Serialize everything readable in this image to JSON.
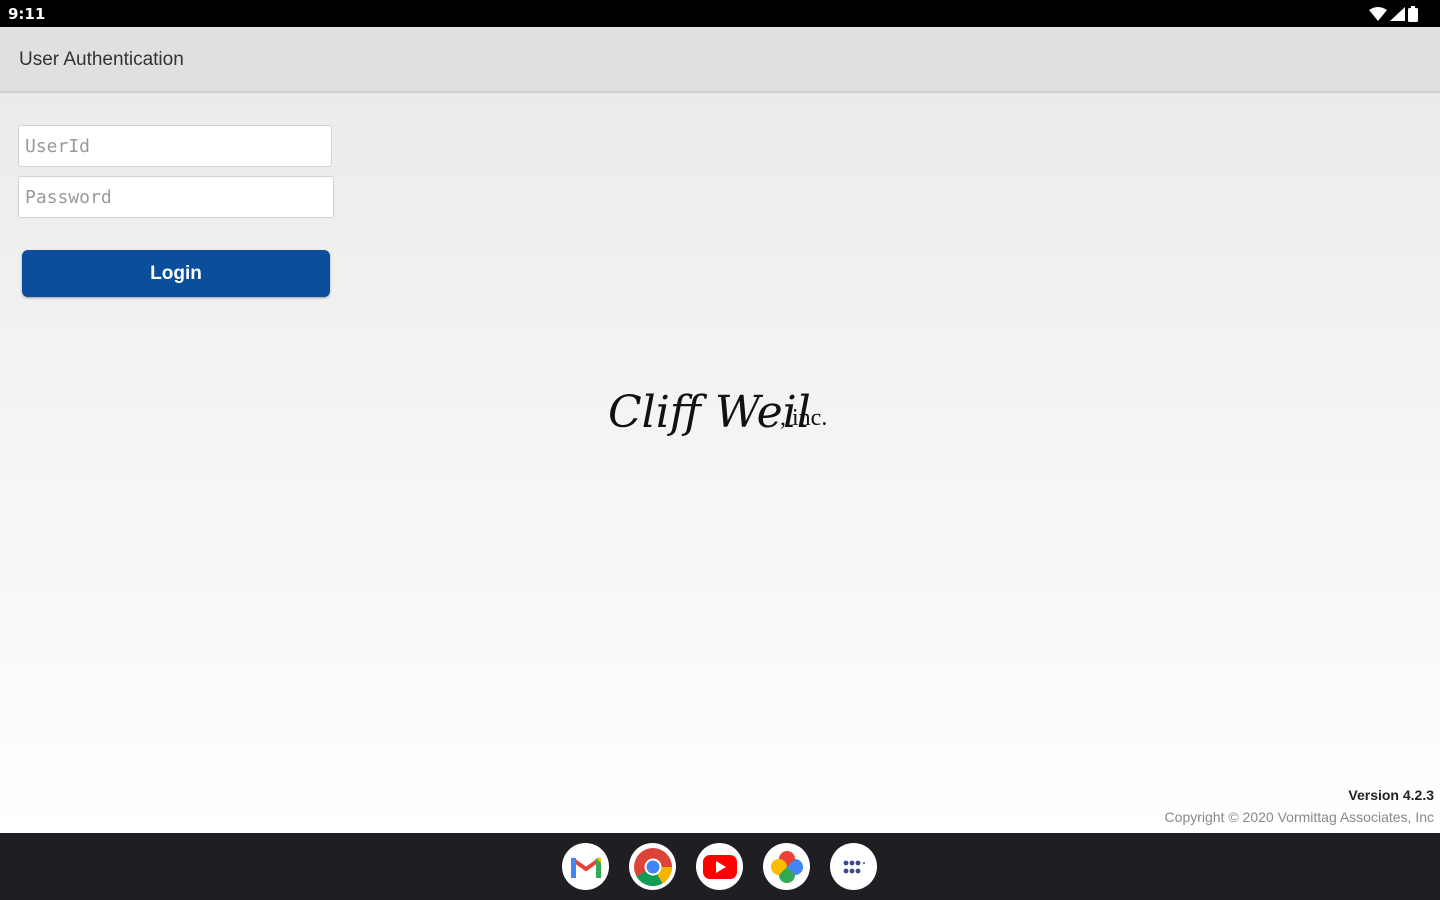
{
  "status_bar": {
    "time": "9:11",
    "icons": [
      "wifi-icon",
      "signal-icon",
      "battery-icon"
    ]
  },
  "header": {
    "title": "User Authentication"
  },
  "form": {
    "userid_placeholder": "UserId",
    "userid_value": "",
    "password_placeholder": "Password",
    "password_value": "",
    "login_label": "Login"
  },
  "logo": {
    "text_script": "Cliff Weil",
    "text_suffix": ", inc."
  },
  "footer": {
    "version": "Version 4.2.3",
    "copyright": "Copyright © 2020 Vormittag Associates, Inc"
  },
  "dock": {
    "apps": [
      "gmail-icon",
      "chrome-icon",
      "youtube-icon",
      "photos-icon",
      "app-drawer-icon"
    ]
  },
  "colors": {
    "primary_button": "#0b4e9b",
    "header_bg": "#e0e0e0",
    "nav_bar": "#1f1f23"
  }
}
